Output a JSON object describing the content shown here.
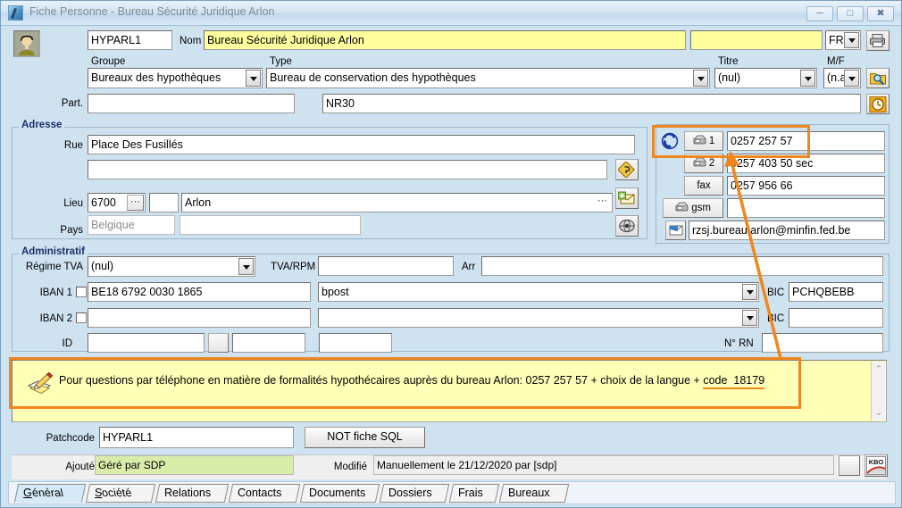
{
  "window": {
    "title": "Fiche Personne - Bureau Sécurité Juridique Arlon",
    "minimize_label": "—",
    "maximize_label": "▣",
    "close_label": "✕"
  },
  "header": {
    "code_value": "HYPARL1",
    "nom_label": "Nom",
    "nom_value": "Bureau Sécurité Juridique Arlon",
    "nom2_value": "",
    "lang_value": "FR",
    "groupe_label": "Groupe",
    "groupe_value": "Bureaux des hypothèques",
    "type_label": "Type",
    "type_value": "Bureau de conservation des hypothèques",
    "titre_label": "Titre",
    "titre_value": "(nul)",
    "mf_label": "M/F",
    "mf_value": "(n.a",
    "part_label": "Part.",
    "part_value": "",
    "nr_value": "NR30",
    "print_icon": "printer-icon",
    "search_icon": "folder-search-icon",
    "history_icon": "clock-icon",
    "person_icon": "person-avatar-icon"
  },
  "adresse": {
    "group_label": "Adresse",
    "rue_label": "Rue",
    "rue_value": "Place Des Fusillés",
    "rue2_value": "",
    "lieu_label": "Lieu",
    "lieu_code": "6700",
    "lieu_ellipsis": "···",
    "lieu_sub": "",
    "lieu_city": "Arlon",
    "lieu_city_ellipsis": "···",
    "pays_label": "Pays",
    "pays_value": "Belgique",
    "pays_extra": "",
    "map_icon": "road-sign-icon",
    "mail_icon": "new-mail-icon",
    "web_icon": "globe-icon"
  },
  "contacts": {
    "phone_icon": "phone-ring-icon",
    "tel1_label": "1",
    "tel1_value": "0257 257 57",
    "tel2_label": "2",
    "tel2_value": "0257 403 50 sec",
    "fax_label": "fax",
    "fax_value": "0257 956 66",
    "gsm_label": "gsm",
    "gsm_value": "",
    "email_icon": "email-send-icon",
    "email_value": "rzsj.bureau.arlon@minfin.fed.be"
  },
  "administratif": {
    "group_label": "Administratif",
    "regime_tva_label": "Régime TVA",
    "regime_tva_value": "(nul)",
    "tva_rpm_label": "TVA/RPM",
    "tva_rpm_value": "",
    "arr_label": "Arr",
    "arr_value": "",
    "iban1_label": "IBAN 1",
    "iban1_value": "BE18 6792 0030 1865",
    "bank1_value": "bpost",
    "bic1_label": "BIC",
    "bic1_value": "PCHQBEBB",
    "iban2_label": "IBAN 2",
    "iban2_value": "",
    "bank2_value": "",
    "bic2_label": "BIC",
    "bic2_value": "",
    "id_label": "ID",
    "id_value": "",
    "id_value2": "",
    "id_value3": "",
    "nrn_label": "N° RN",
    "nrn_value": ""
  },
  "note": {
    "icon": "note-pencil-icon",
    "text_before": "Pour questions par téléphone en matière de formalités hypothécaires auprès du bureau  Arlon: 0257 257 57 + choix de la langue + ",
    "code_label": "code",
    "code_value": "18179",
    "scroll_up": "⌃",
    "scroll_down": "⌄"
  },
  "footer": {
    "patchcode_label": "Patchcode",
    "patchcode_value": "HYPARL1",
    "sql_button_label": "NOT fiche SQL",
    "ajoute_label": "Ajouté",
    "ajoute_value": "Géré par SDP",
    "modifie_label": "Modifié",
    "modifie_value": "Manuellement le 21/12/2020 par [sdp]",
    "kbo_label": "KBO"
  },
  "tabs": [
    {
      "label": "Général",
      "accel": "G",
      "active": true
    },
    {
      "label": "Société",
      "accel": "S",
      "active": false
    },
    {
      "label": "Relations",
      "accel": "",
      "active": false
    },
    {
      "label": "Contacts",
      "accel": "",
      "active": false
    },
    {
      "label": "Documents",
      "accel": "",
      "active": false
    },
    {
      "label": "Dossiers",
      "accel": "",
      "active": false
    },
    {
      "label": "Frais",
      "accel": "",
      "active": false
    },
    {
      "label": "Bureaux",
      "accel": "",
      "active": false
    }
  ],
  "annotation": {
    "accent_color": "#f0861e"
  }
}
